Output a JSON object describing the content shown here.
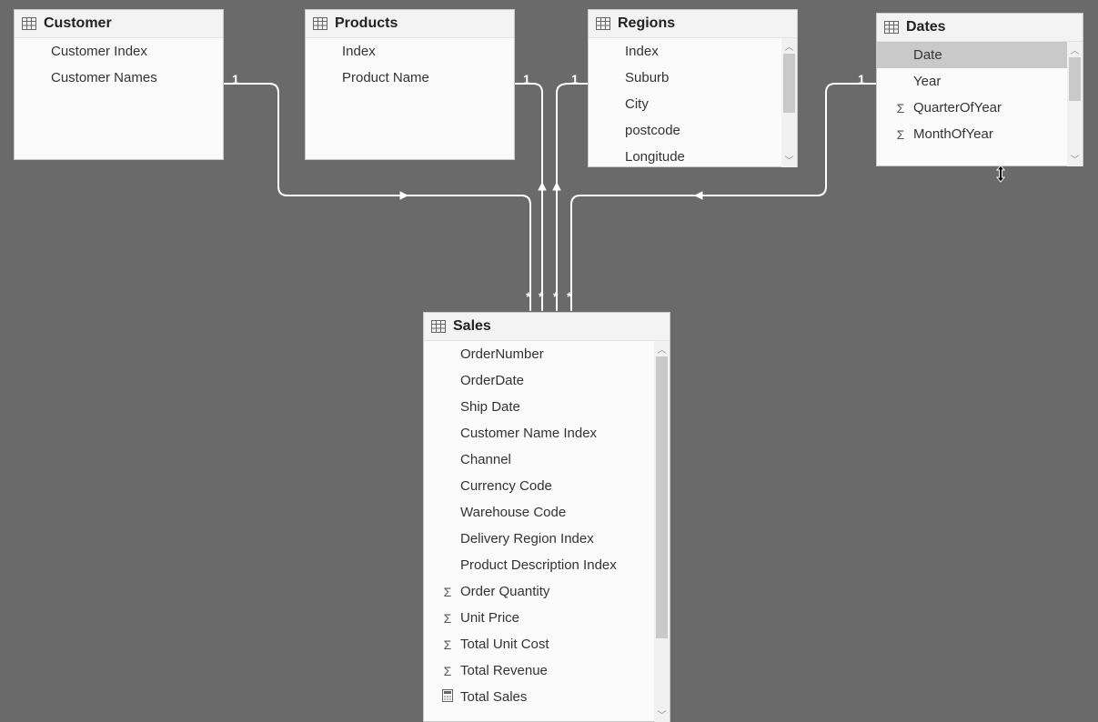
{
  "cardinality_one": "1",
  "cardinality_many": "*",
  "tables": {
    "customer": {
      "title": "Customer",
      "fields": [
        {
          "label": "Customer Index",
          "icon": ""
        },
        {
          "label": "Customer Names",
          "icon": ""
        }
      ]
    },
    "products": {
      "title": "Products",
      "fields": [
        {
          "label": "Index",
          "icon": ""
        },
        {
          "label": "Product Name",
          "icon": ""
        }
      ]
    },
    "regions": {
      "title": "Regions",
      "fields": [
        {
          "label": "Index",
          "icon": ""
        },
        {
          "label": "Suburb",
          "icon": ""
        },
        {
          "label": "City",
          "icon": ""
        },
        {
          "label": "postcode",
          "icon": ""
        },
        {
          "label": "Longitude",
          "icon": ""
        }
      ]
    },
    "dates": {
      "title": "Dates",
      "fields": [
        {
          "label": "Date",
          "icon": "",
          "selected": true
        },
        {
          "label": "Year",
          "icon": ""
        },
        {
          "label": "QuarterOfYear",
          "icon": "sigma"
        },
        {
          "label": "MonthOfYear",
          "icon": "sigma"
        }
      ]
    },
    "sales": {
      "title": "Sales",
      "fields": [
        {
          "label": "OrderNumber",
          "icon": ""
        },
        {
          "label": "OrderDate",
          "icon": ""
        },
        {
          "label": "Ship Date",
          "icon": ""
        },
        {
          "label": "Customer Name Index",
          "icon": ""
        },
        {
          "label": "Channel",
          "icon": ""
        },
        {
          "label": "Currency Code",
          "icon": ""
        },
        {
          "label": "Warehouse Code",
          "icon": ""
        },
        {
          "label": "Delivery Region Index",
          "icon": ""
        },
        {
          "label": "Product Description Index",
          "icon": ""
        },
        {
          "label": "Order Quantity",
          "icon": "sigma"
        },
        {
          "label": "Unit Price",
          "icon": "sigma"
        },
        {
          "label": "Total Unit Cost",
          "icon": "sigma"
        },
        {
          "label": "Total Revenue",
          "icon": "sigma"
        },
        {
          "label": "Total Sales",
          "icon": "calc"
        }
      ]
    }
  }
}
